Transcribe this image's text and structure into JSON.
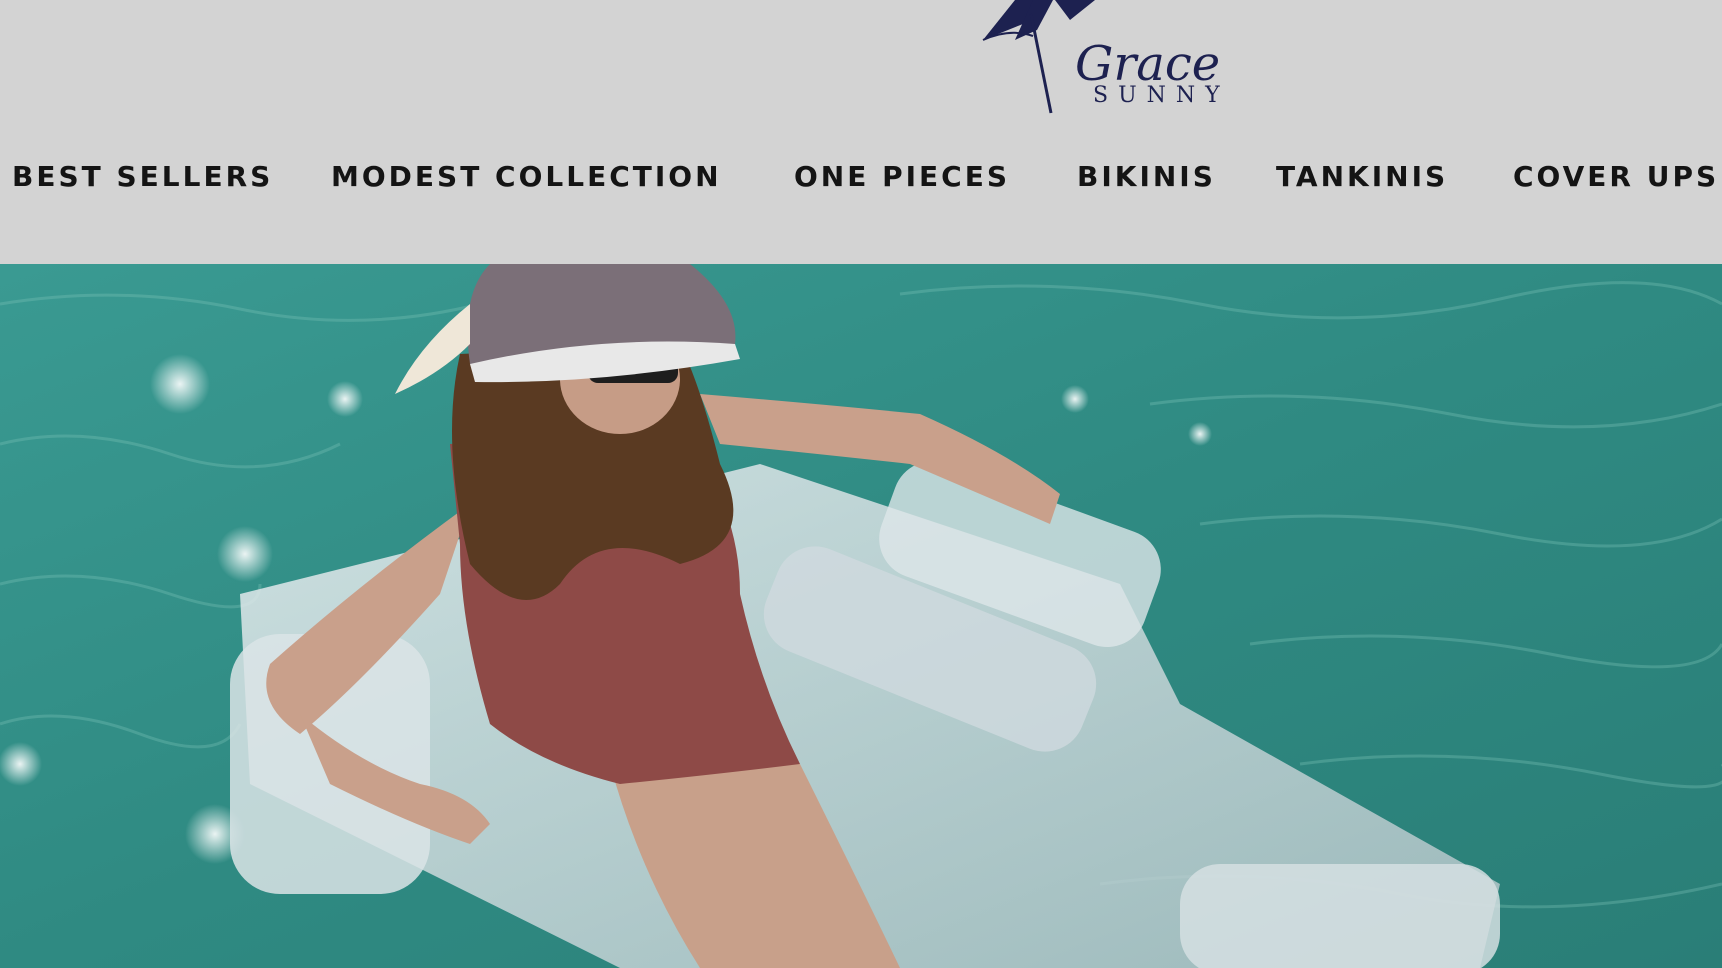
{
  "brand": {
    "name_script": "Grace",
    "name_caps": "SUNNY"
  },
  "nav": {
    "items": [
      {
        "label": "BEST SELLERS"
      },
      {
        "label": "MODEST COLLECTION"
      },
      {
        "label": "ONE PIECES"
      },
      {
        "label": "BIKINIS"
      },
      {
        "label": "TANKINIS"
      },
      {
        "label": "COVER UPS"
      }
    ]
  },
  "colors": {
    "header_bg": "#d3d3d3",
    "nav_text": "#141414",
    "logo_navy": "#1d2150",
    "water": "#2f8e86",
    "swimsuit": "#8e4a47"
  }
}
